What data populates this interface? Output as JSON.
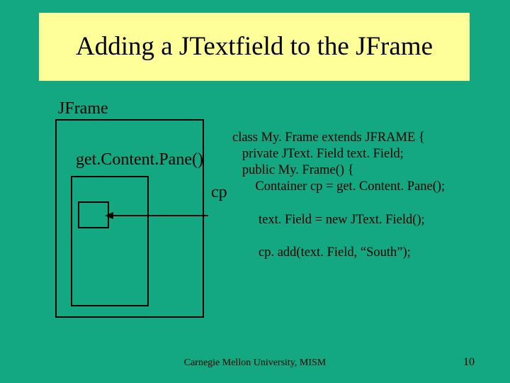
{
  "title": "Adding a JTextfield to the JFrame",
  "labels": {
    "jframe": "JFrame",
    "getContentPane": "get.Content.Pane()",
    "cp": "cp"
  },
  "code": {
    "l1": "class My. Frame extends JFRAME {",
    "l2": "   private JText. Field text. Field;",
    "l3": "   public My. Frame() {",
    "l4": "       Container cp = get. Content. Pane();",
    "l5": "",
    "l6": "        text. Field = new JText. Field();",
    "l7": "",
    "l8": "        cp. add(text. Field, “South”);"
  },
  "footer": "Carnegie Mellon University, MISM",
  "page": "10"
}
